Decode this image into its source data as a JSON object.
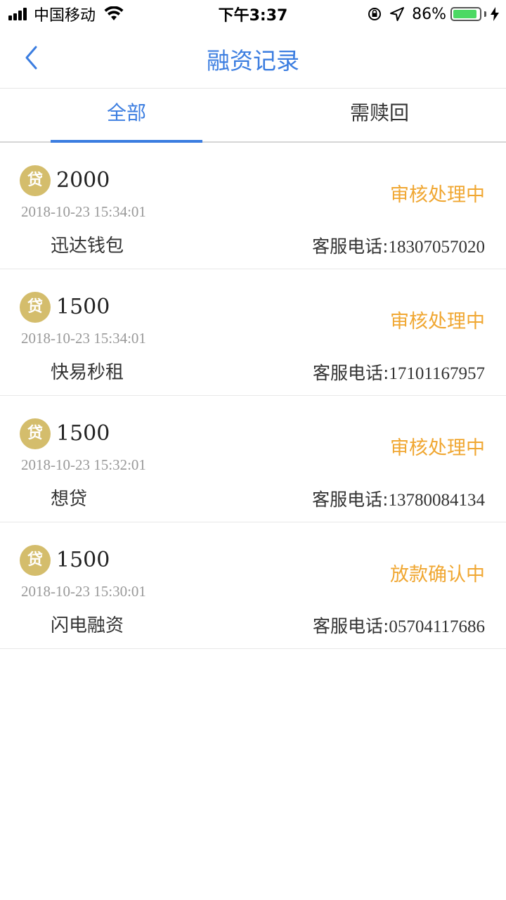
{
  "status_bar": {
    "carrier": "中国移动",
    "time": "下午3:37",
    "battery": "86%",
    "battery_level": 0.86
  },
  "nav": {
    "title": "融资记录",
    "back_icon": "chevron-left-icon"
  },
  "tabs": [
    {
      "label": "全部",
      "active": true
    },
    {
      "label": "需赎回",
      "active": false
    }
  ],
  "colors": {
    "accent": "#3b7de0",
    "status_orange": "#f0a732",
    "badge_gold": "#d4bd6c"
  },
  "records": [
    {
      "badge": "贷",
      "amount": "2000",
      "status": "审核处理中",
      "time": "2018-10-23 15:34:01",
      "lender": "迅达钱包",
      "phone_label": "客服电话:",
      "phone": "18307057020"
    },
    {
      "badge": "贷",
      "amount": "1500",
      "status": "审核处理中",
      "time": "2018-10-23 15:34:01",
      "lender": "快易秒租",
      "phone_label": "客服电话:",
      "phone": "17101167957"
    },
    {
      "badge": "贷",
      "amount": "1500",
      "status": "审核处理中",
      "time": "2018-10-23 15:32:01",
      "lender": "想贷",
      "phone_label": "客服电话:",
      "phone": "13780084134"
    },
    {
      "badge": "贷",
      "amount": "1500",
      "status": "放款确认中",
      "time": "2018-10-23 15:30:01",
      "lender": "闪电融资",
      "phone_label": "客服电话:",
      "phone": "05704117686"
    }
  ]
}
